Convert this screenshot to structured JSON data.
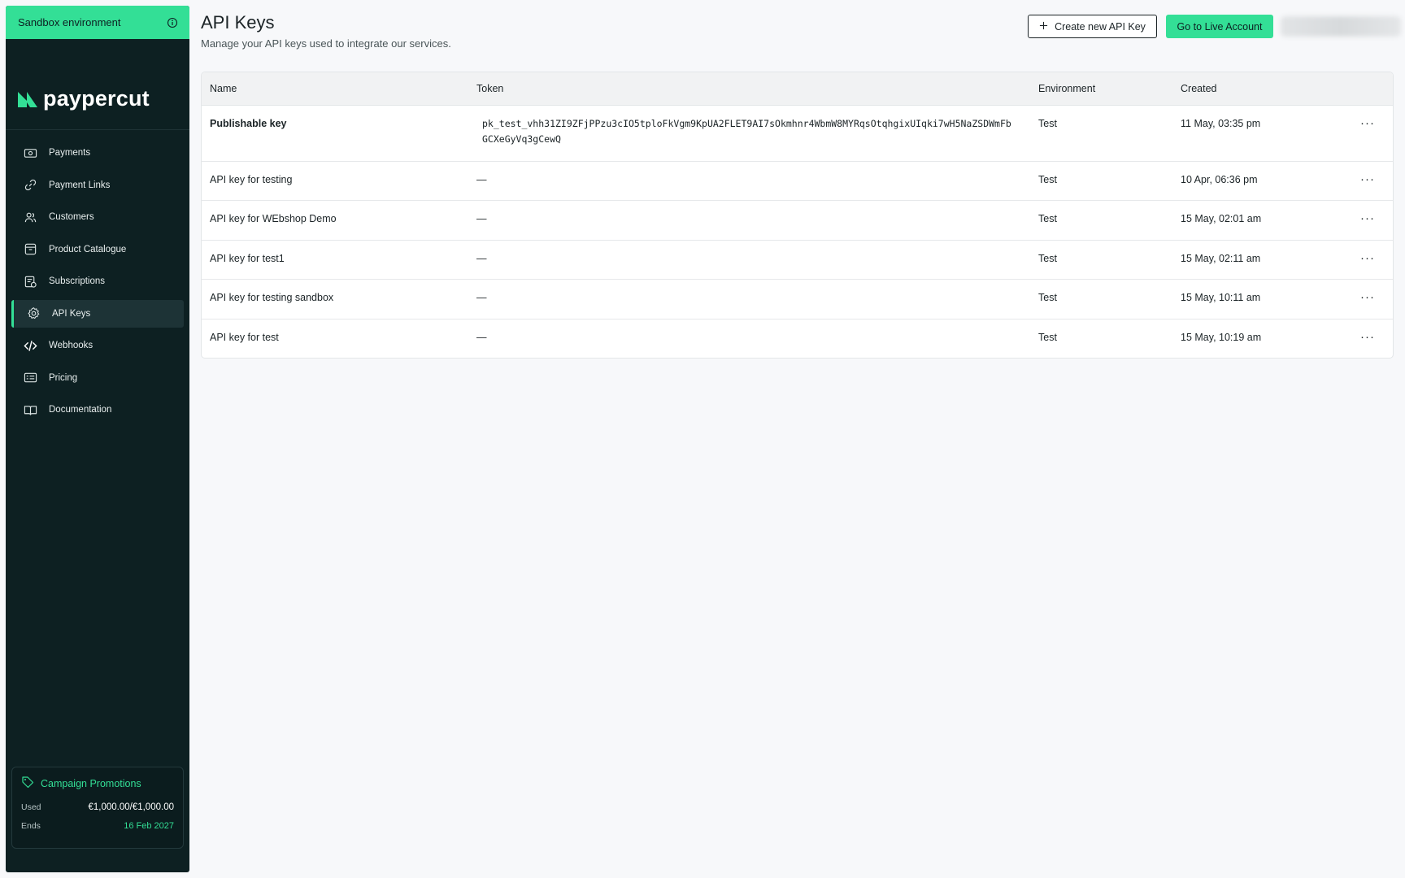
{
  "sidebar": {
    "env_banner": "Sandbox environment",
    "logo": "paypercut",
    "items": [
      {
        "label": "Payments",
        "icon": "payments-icon",
        "active": false
      },
      {
        "label": "Payment Links",
        "icon": "link-icon",
        "active": false
      },
      {
        "label": "Customers",
        "icon": "customers-icon",
        "active": false
      },
      {
        "label": "Product Catalogue",
        "icon": "box-icon",
        "active": false
      },
      {
        "label": "Subscriptions",
        "icon": "subscriptions-icon",
        "active": false
      },
      {
        "label": "API Keys",
        "icon": "gear-icon",
        "active": true
      },
      {
        "label": "Webhooks",
        "icon": "code-icon",
        "active": false
      },
      {
        "label": "Pricing",
        "icon": "pricing-icon",
        "active": false
      },
      {
        "label": "Documentation",
        "icon": "book-icon",
        "active": false
      }
    ],
    "promo": {
      "title": "Campaign Promotions",
      "used_label": "Used",
      "used_value": "€1,000.00/€1,000.00",
      "ends_label": "Ends",
      "ends_value": "16 Feb 2027"
    }
  },
  "header": {
    "title": "API Keys",
    "subtitle": "Manage your API keys used to integrate our services.",
    "create_button": "Create new API Key",
    "live_button": "Go to Live Account"
  },
  "table": {
    "columns": {
      "name": "Name",
      "token": "Token",
      "environment": "Environment",
      "created": "Created"
    },
    "rows": [
      {
        "name": "Publishable key",
        "token": "pk_test_vhh31ZI9ZFjPPzu3cIO5tploFkVgm9KpUA2FLET9AI7sOkmhnr4WbmW8MYRqsOtqhgixUIqki7wH5NaZSDWmFbGCXeGyVq3gCewQ",
        "environment": "Test",
        "created": "11 May, 03:35 pm"
      },
      {
        "name": "API key for testing",
        "token": "—",
        "environment": "Test",
        "created": "10 Apr, 06:36 pm"
      },
      {
        "name": "API key for WEbshop Demo",
        "token": "—",
        "environment": "Test",
        "created": "15 May, 02:01 am"
      },
      {
        "name": "API key for test1",
        "token": "—",
        "environment": "Test",
        "created": "15 May, 02:11 am"
      },
      {
        "name": "API key for testing sandbox",
        "token": "—",
        "environment": "Test",
        "created": "15 May, 10:11 am"
      },
      {
        "name": "API key for test",
        "token": "—",
        "environment": "Test",
        "created": "15 May, 10:19 am"
      }
    ],
    "row_menu": "···"
  },
  "colors": {
    "accent": "#33df96",
    "sidebar_bg": "#0d2022",
    "page_bg": "#f7f8fa"
  }
}
